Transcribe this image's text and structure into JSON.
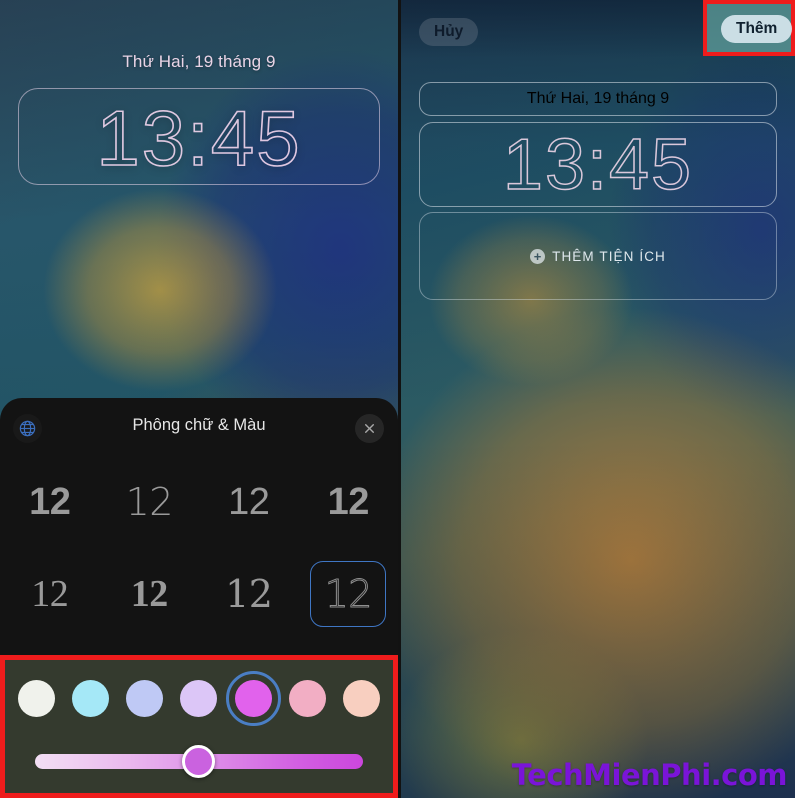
{
  "left_phone": {
    "lockscreen": {
      "date": "Thứ Hai, 19 tháng 9",
      "time": "13:45"
    },
    "font_sheet": {
      "title": "Phông chữ & Màu",
      "globe_icon": "globe-icon",
      "close_icon": "close-icon",
      "font_options": [
        {
          "label": "12",
          "style": "sans-bold",
          "selected": false
        },
        {
          "label": "12",
          "style": "sans-light",
          "selected": false
        },
        {
          "label": "12",
          "style": "sans-reg",
          "selected": false
        },
        {
          "label": "12",
          "style": "sans-cond",
          "selected": false
        },
        {
          "label": "12",
          "style": "serif-reg",
          "selected": false
        },
        {
          "label": "12",
          "style": "serif-bold",
          "selected": false
        },
        {
          "label": "12",
          "style": "serif-alt",
          "selected": false
        },
        {
          "label": "12",
          "style": "outline",
          "selected": true
        }
      ]
    },
    "color_picker": {
      "swatches": [
        {
          "name": "white",
          "hex": "#f0f2ec",
          "selected": false
        },
        {
          "name": "cyan",
          "hex": "#a5e8f7",
          "selected": false
        },
        {
          "name": "periwinkle",
          "hex": "#bfc9f5",
          "selected": false
        },
        {
          "name": "lavender",
          "hex": "#dcc6f7",
          "selected": false
        },
        {
          "name": "magenta",
          "hex": "#e162ec",
          "selected": true
        },
        {
          "name": "pink",
          "hex": "#f2aec4",
          "selected": false
        },
        {
          "name": "peach",
          "hex": "#f8cfc0",
          "selected": false
        }
      ],
      "intensity_slider": {
        "value_percent": 50,
        "gradient_from": "#f3dff4",
        "gradient_to": "#cb46dd",
        "thumb_hex": "#ca62df"
      },
      "highlight_color": "#ef1c1c"
    }
  },
  "right_phone": {
    "toolbar": {
      "cancel_label": "Hủy",
      "add_label": "Thêm",
      "add_highlight_color": "#ef1c1c"
    },
    "lockscreen": {
      "date": "Thứ Hai, 19 tháng 9",
      "time": "13:45",
      "widget_placeholder": "THÊM TIỆN ÍCH",
      "widget_plus_icon": "plus-circle-icon"
    }
  },
  "watermark": {
    "text": "TechMienPhi.com",
    "hex": "#7a14d8"
  }
}
